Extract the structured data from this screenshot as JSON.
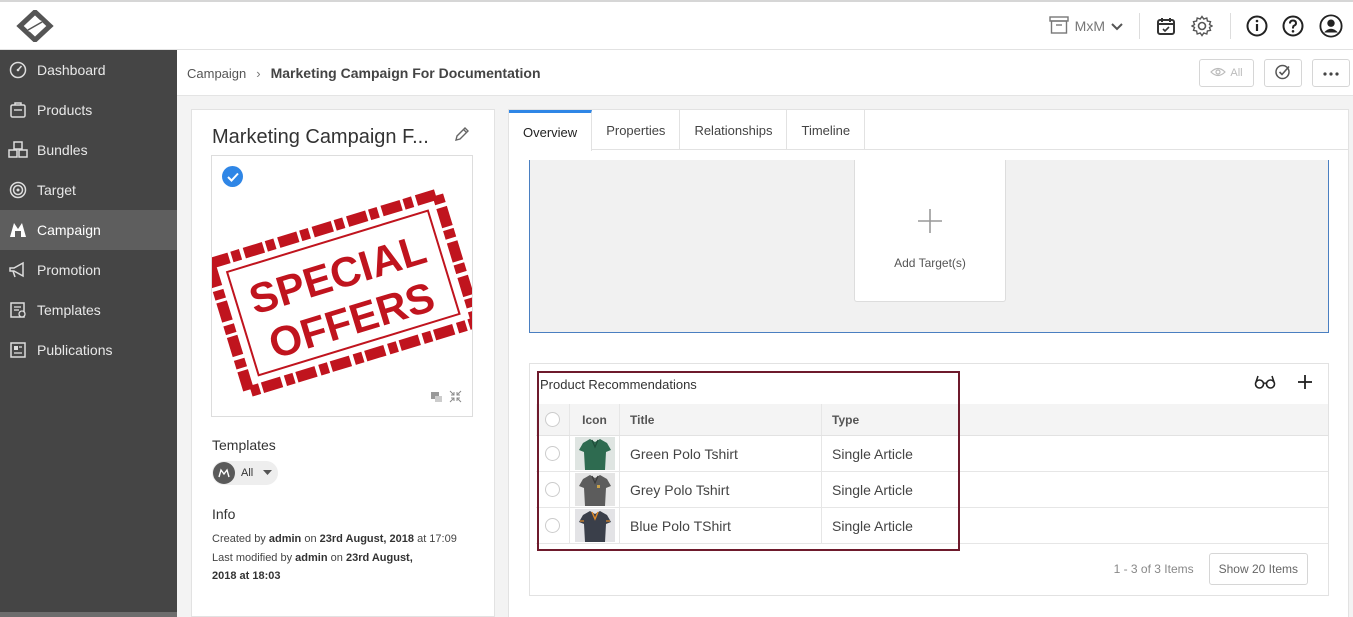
{
  "topbar": {
    "workspace": "MxM"
  },
  "sidebar": {
    "items": [
      {
        "label": "Dashboard",
        "icon": "dashboard-icon"
      },
      {
        "label": "Products",
        "icon": "products-icon"
      },
      {
        "label": "Bundles",
        "icon": "bundles-icon"
      },
      {
        "label": "Target",
        "icon": "target-icon"
      },
      {
        "label": "Campaign",
        "icon": "campaign-icon",
        "active": true
      },
      {
        "label": "Promotion",
        "icon": "megaphone-icon"
      },
      {
        "label": "Templates",
        "icon": "templates-icon"
      },
      {
        "label": "Publications",
        "icon": "publications-icon"
      }
    ]
  },
  "breadcrumb": {
    "parent": "Campaign",
    "separator": "›",
    "current": "Marketing Campaign For Documentation"
  },
  "toolbar": {
    "view_label": "All"
  },
  "detail": {
    "title": "Marketing Campaign F...",
    "templates_label": "Templates",
    "template_chip": "All",
    "info_label": "Info",
    "created_prefix": "Created by",
    "created_by": "admin",
    "created_on": "on",
    "created_date": "23rd August, 2018",
    "created_at": "at 17:09",
    "modified_prefix": "Last modified by",
    "modified_by": "admin",
    "modified_on": "on",
    "modified_date": "23rd August,",
    "modified_rest": "2018 at 18:03",
    "image_text_1": "SPECIAL",
    "image_text_2": "OFFERS"
  },
  "tabs": [
    {
      "label": "Overview",
      "active": true
    },
    {
      "label": "Properties"
    },
    {
      "label": "Relationships"
    },
    {
      "label": "Timeline"
    }
  ],
  "targets": {
    "add_label": "Add Target(s)"
  },
  "recommendations": {
    "title": "Product Recommendations",
    "columns": [
      "Icon",
      "Title",
      "Type"
    ],
    "rows": [
      {
        "title": "Green Polo Tshirt",
        "type": "Single Article",
        "color": "#2e6b50"
      },
      {
        "title": "Grey Polo Tshirt",
        "type": "Single Article",
        "color": "#5c5c5c"
      },
      {
        "title": "Blue Polo TShirt",
        "type": "Single Article",
        "color": "#3a3f4a"
      }
    ],
    "count": "1 - 3 of 3 Items",
    "show_label": "Show 20 Items"
  },
  "colors": {
    "accent": "#2f86e6",
    "sidebar": "#454545",
    "highlight": "#6e1a2c",
    "stamp": "#c0141e"
  }
}
